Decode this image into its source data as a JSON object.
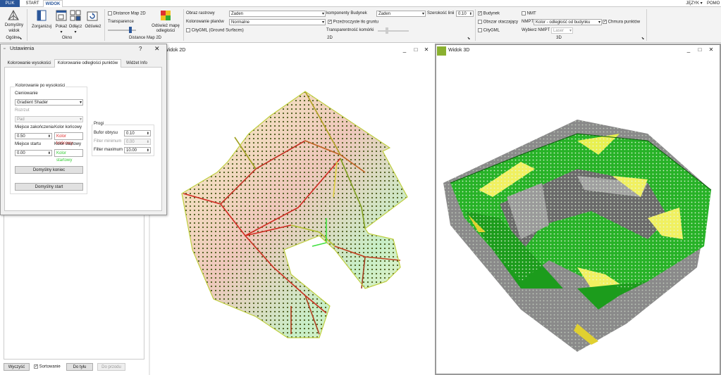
{
  "tabs": {
    "plik": "PLIK",
    "start": "START",
    "widok": "WIDOK"
  },
  "right_menu": {
    "language": "JĘZYK ▾",
    "help": "POMO"
  },
  "ribbon": {
    "default_view": {
      "l1": "Domyślny",
      "l2": "widok"
    },
    "group_general": "Ogólne",
    "organize": "Zorganizuj",
    "show": {
      "l1": "Pokaż",
      "l2": "▾"
    },
    "detach": {
      "l1": "Odłącz",
      "l2": "▾"
    },
    "refresh": "Odśwież",
    "group_window": "Okno",
    "distance_map_checkbox": "Distance Map 2D",
    "transparence_label": "Transparence",
    "refresh_map": {
      "l1": "Odśwież mapę",
      "l2": "odległości"
    },
    "group_distance_map": "Distance Map 2D",
    "raster_label": "Obraz rastrowy",
    "raster_value": "Żaden",
    "plan_coloring_label": "Kolorowanie planów",
    "plan_coloring_value": "Normalne",
    "citygml_ground": "CityGML (Ground Surfaces)",
    "building_components_label": "komponenty Budynek",
    "building_components_value": "Żaden",
    "line_width_label": "Szerokość linii",
    "line_width_value": "0.10",
    "transparent_ground": "Przeźroczyste tło gruntu",
    "cell_transparency": "Transparentność komórki",
    "group_2d": "2D",
    "building_cb": "Budynek",
    "nmt_cb": "NMT",
    "surrounding_cb": "Obszar otaczający",
    "nmpt_label": "NMPT",
    "nmpt_value": "Kolor - odległość od budynku",
    "point_cloud_cb": "Chmura punktów",
    "citygml_cb": "CityGML",
    "select_nmpt_label": "Wybierz NMPT",
    "select_nmpt_value": "Laser",
    "group_3d": "3D"
  },
  "view2d": {
    "title": "Widok 2D"
  },
  "view3d": {
    "title": "Widok 3D"
  },
  "window_buttons": {
    "minimize": "_",
    "restore": "□",
    "close": "✕"
  },
  "bottom_bar": {
    "clear": "Wyczyść",
    "sort": "Sortowanie",
    "back": "Do tyłu",
    "forward": "Do przodu"
  },
  "dialog": {
    "title": "Ustawienia",
    "help": "?",
    "close": "✕",
    "tabs": [
      "Kolorowanie wysokości",
      "Kolorowanie odległości punktów",
      "Widżet Info"
    ],
    "group_title": "Kolorowanie po wysokości",
    "shading_label": "Cieniowanie",
    "shading_value": "Gradient Shader",
    "spread_label": "Rozrzut",
    "spread_value": "Pad",
    "end_place_label": "Miejsce zakończenia",
    "end_place_value": "0.50",
    "end_color_label": "Kolor końcowy",
    "end_color_value": "Kolor końcowy",
    "start_place_label": "Miejsce startu",
    "start_place_value": "0.00",
    "start_color_label": "Kolor startowy",
    "start_color_value": "Kolor startowy",
    "default_end_btn": "Domyślny koniec",
    "default_start_btn": "Domyślny start",
    "thresholds_title": "Progi",
    "buffer_label": "Bufor obrysu",
    "buffer_value": "0.10",
    "filter_min_label": "Filter minimum",
    "filter_min_value": "0.00",
    "filter_max_label": "Filter maximum",
    "filter_max_value": "10.00"
  },
  "colors": {
    "accent": "#2b579a",
    "end_color": "#e03030",
    "start_color": "#33cc33"
  }
}
